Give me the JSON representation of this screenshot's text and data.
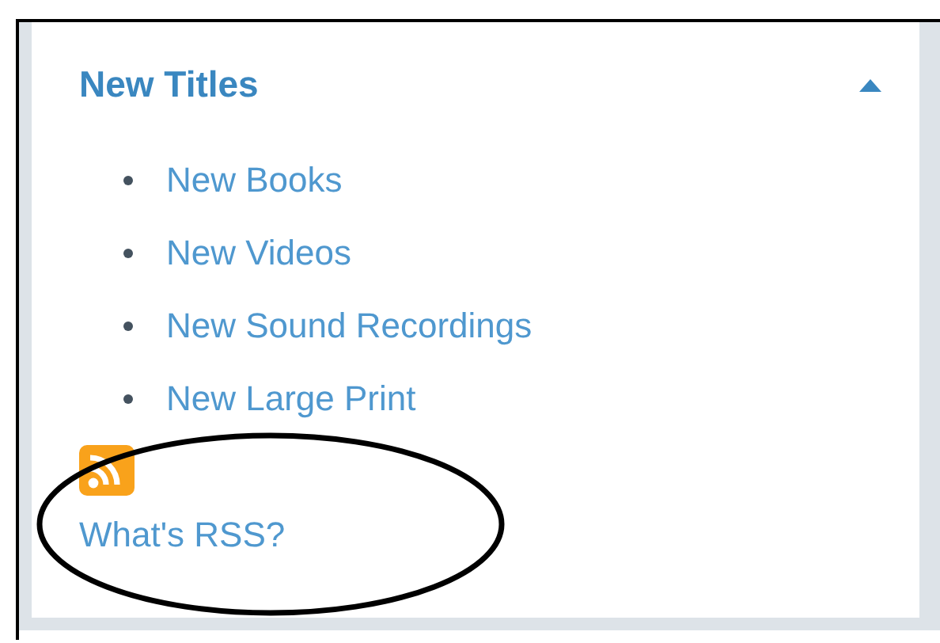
{
  "panel": {
    "title": "New Titles",
    "expanded": true,
    "links": [
      "New Books",
      "New Videos",
      "New Sound Recordings",
      "New Large Print"
    ],
    "rss_link": "What's RSS?"
  }
}
